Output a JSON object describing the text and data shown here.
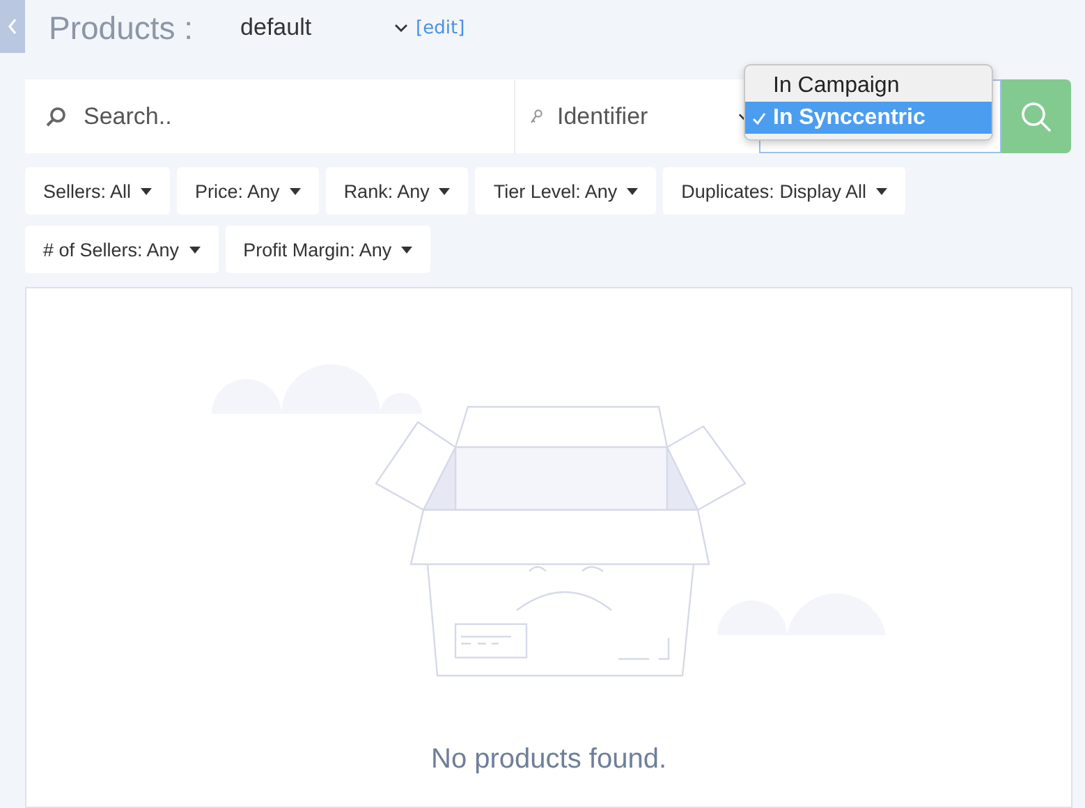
{
  "header": {
    "title": "Products :",
    "view_select": "default",
    "edit_link": "[edit]"
  },
  "search": {
    "placeholder": "Search..",
    "field_select": "Identifier"
  },
  "source_menu": {
    "options": [
      {
        "label": "In Campaign",
        "selected": false
      },
      {
        "label": "In Synccentric",
        "selected": true
      }
    ]
  },
  "filters": [
    {
      "label": "Sellers: All"
    },
    {
      "label": "Price: Any"
    },
    {
      "label": "Rank: Any"
    },
    {
      "label": "Tier Level: Any"
    },
    {
      "label": "Duplicates: Display All"
    },
    {
      "label": "# of Sellers: Any"
    },
    {
      "label": "Profit Margin: Any"
    }
  ],
  "empty_state": {
    "message": "No products found."
  }
}
